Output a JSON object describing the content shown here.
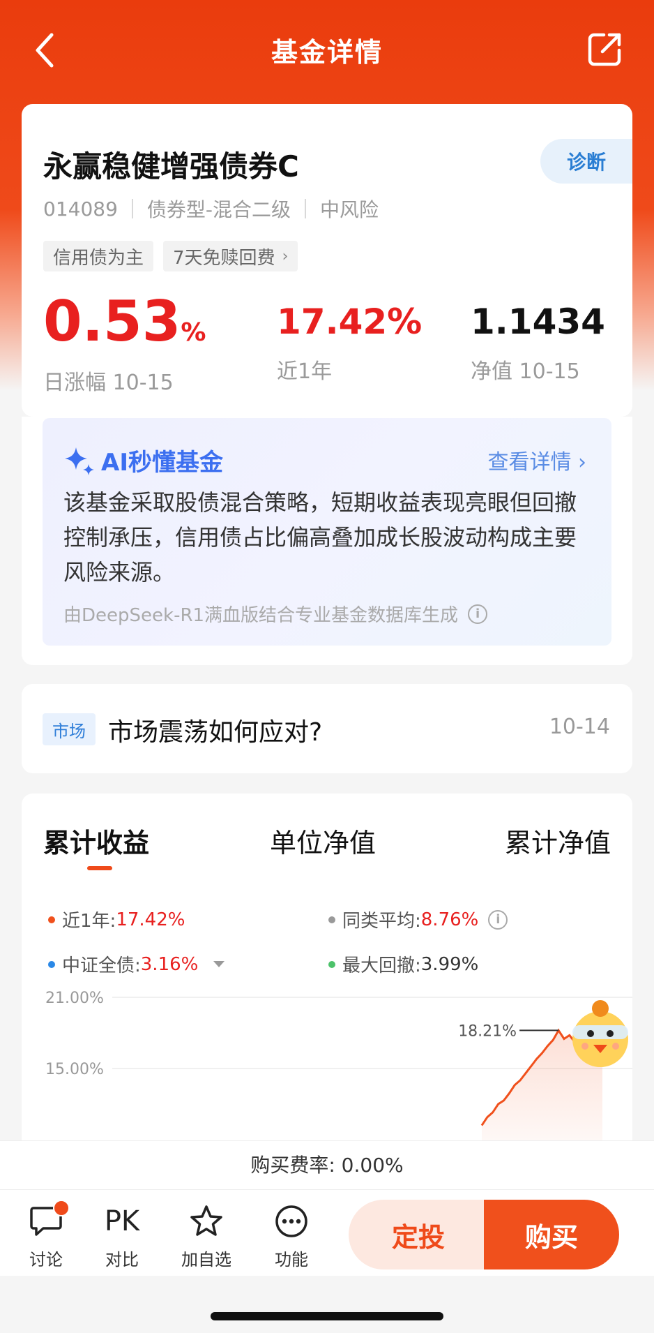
{
  "header": {
    "title": "基金详情",
    "back_icon": "chevron-left-icon",
    "share_icon": "share-icon"
  },
  "fund": {
    "name": "永赢稳健增强债券C",
    "diagnose_label": "诊断",
    "code": "014089",
    "type": "债券型-混合二级",
    "risk": "中风险",
    "tags": [
      "信用债为主",
      "7天免赎回费"
    ],
    "tag_chevron": "›",
    "daily_change": "0.53",
    "daily_change_unit": "%",
    "daily_change_label": "日涨幅 10-15",
    "one_year": "17.42%",
    "one_year_label": "近1年",
    "nav": "1.1434",
    "nav_label": "净值 10-15"
  },
  "ai": {
    "title": "AI秒懂基金",
    "more": "查看详情 ›",
    "text": "该基金采取股债混合策略，短期收益表现亮眼但回撤控制承压，信用债占比偏高叠加成长股波动构成主要风险来源。",
    "note": "由DeepSeek-R1满血版结合专业基金数据库生成",
    "info_glyph": "i"
  },
  "market": {
    "tag": "市场",
    "title": "市场震荡如何应对?",
    "date": "10-14"
  },
  "chart_tabs": [
    "累计收益",
    "单位净值",
    "累计净值"
  ],
  "legend": {
    "l1_label": "近1年:",
    "l1_value": "17.42%",
    "l2_label": "同类平均:",
    "l2_value": "8.76%",
    "l3_label": "中证全债:",
    "l3_value": "3.16%",
    "l4_label": "最大回撤:",
    "l4_value": "3.99%",
    "colors": {
      "fund": "#f0501c",
      "peer": "#999999",
      "index": "#2a88e6",
      "drawdown": "#4cc26a"
    }
  },
  "chart_data": {
    "type": "line",
    "y_ticks": [
      "21.00%",
      "15.00%"
    ],
    "y_tick_values": [
      21,
      15
    ],
    "peak_label": "18.21%",
    "peak_value": 18.21,
    "series": [
      {
        "name": "近1年",
        "values": [
          10.2,
          10.9,
          11.3,
          12.0,
          12.3,
          12.9,
          13.6,
          14.0,
          14.6,
          15.2,
          15.8,
          16.3,
          16.9,
          17.4,
          18.21,
          17.5,
          17.8,
          17.2,
          17.9,
          17.6,
          18.0,
          17.7,
          17.8
        ]
      }
    ],
    "grid": true,
    "legend_placement": "top"
  },
  "bottom": {
    "fee": "购买费率: 0.00%",
    "actions": [
      "讨论",
      "对比",
      "加自选",
      "功能"
    ],
    "pk": "PK",
    "dingtou": "定投",
    "buy": "购买"
  }
}
